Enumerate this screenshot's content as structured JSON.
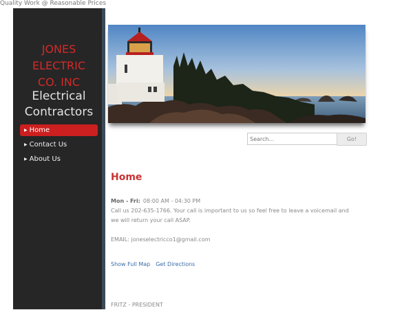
{
  "tagline": "Quality Work @ Reasonable Prices",
  "brand": {
    "lines": [
      "JONES",
      "ELECTRIC",
      "CO. INC"
    ],
    "subtitle_lines": [
      "Electrical",
      "Contractors"
    ]
  },
  "nav": {
    "items": [
      {
        "label": "Home",
        "active": true
      },
      {
        "label": "Contact Us",
        "active": false
      },
      {
        "label": "About Us",
        "active": false
      }
    ]
  },
  "search": {
    "placeholder": "Search...",
    "button_label": "Go!"
  },
  "main": {
    "title": "Home",
    "hours_label": "Mon - Fri:",
    "hours_value": "08:00 AM - 04:30 PM",
    "call_line1": "Call us 202-635-1766. Your call is important to us so feel free to leave a voicemail and",
    "call_line2": "we will return your call ASAP.",
    "email": "EMAIL: joneselectricco1@gmail.com",
    "links": [
      "Show Full Map",
      "Get Directions"
    ],
    "president": "FRITZ - PRESIDENT"
  },
  "colors": {
    "brand_red": "#d42a2a",
    "sidebar_bg": "#262626",
    "link_blue": "#3b6aa8"
  }
}
